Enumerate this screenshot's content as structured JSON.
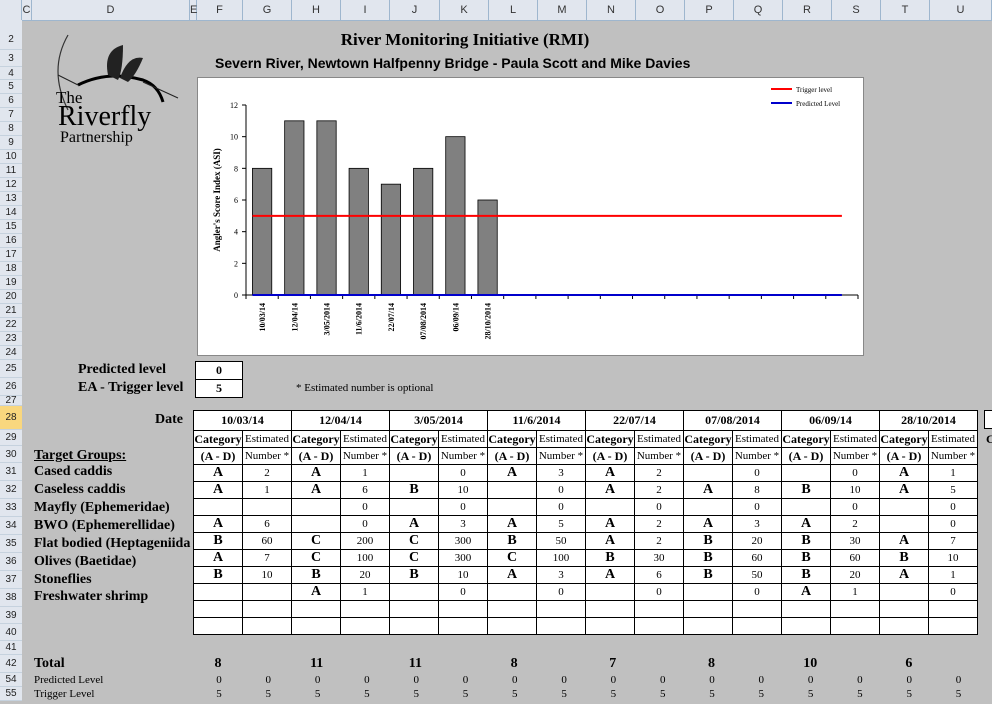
{
  "columns": [
    "C",
    "D",
    "E",
    "F",
    "G",
    "H",
    "I",
    "J",
    "K",
    "L",
    "M",
    "N",
    "O",
    "P",
    "Q",
    "R",
    "S",
    "T",
    "U"
  ],
  "rows": [
    "2",
    "3",
    "4",
    "5",
    "6",
    "7",
    "8",
    "9",
    "10",
    "11",
    "12",
    "13",
    "14",
    "15",
    "16",
    "17",
    "18",
    "19",
    "20",
    "21",
    "22",
    "23",
    "24",
    "25",
    "26",
    "27",
    "28",
    "29",
    "30",
    "31",
    "32",
    "33",
    "34",
    "35",
    "36",
    "37",
    "38",
    "39",
    "40",
    "41",
    "42",
    "54",
    "55"
  ],
  "title": "River Monitoring Initiative (RMI)",
  "subtitle": "Severn River, Newtown Halfpenny Bridge - Paula Scott and Mike Davies",
  "logo": {
    "line1": "The",
    "line2": "Riverfly",
    "line3": "Partnership"
  },
  "predicted_label": "Predicted level",
  "predicted_value": "0",
  "trigger_label": "EA - Trigger level",
  "trigger_value": "5",
  "note": "* Estimated number is optional",
  "date_label": "Date",
  "target_groups_label": "Target Groups:",
  "hdr_category": "Category",
  "hdr_estimated": "Estimated",
  "hdr_ad": "(A - D)",
  "hdr_number": "Number *",
  "overflow_c": "C",
  "dates": [
    "10/03/14",
    "12/04/14",
    "3/05/2014",
    "11/6/2014",
    "22/07/14",
    "07/08/2014",
    "06/09/14",
    "28/10/2014"
  ],
  "groups": [
    {
      "name": "Cased caddis",
      "cells": [
        [
          "A",
          "2"
        ],
        [
          "A",
          "1"
        ],
        [
          "",
          "0"
        ],
        [
          "A",
          "3"
        ],
        [
          "A",
          "2"
        ],
        [
          "",
          "0"
        ],
        [
          "",
          "0"
        ],
        [
          "A",
          "1"
        ]
      ]
    },
    {
      "name": "Caseless caddis",
      "cells": [
        [
          "A",
          "1"
        ],
        [
          "A",
          "6"
        ],
        [
          "B",
          "10"
        ],
        [
          "",
          "0"
        ],
        [
          "A",
          "2"
        ],
        [
          "A",
          "8"
        ],
        [
          "B",
          "10"
        ],
        [
          "A",
          "5"
        ]
      ]
    },
    {
      "name": "Mayfly (Ephemeridae)",
      "cells": [
        [
          "",
          ""
        ],
        [
          "",
          "0"
        ],
        [
          "",
          "0"
        ],
        [
          "",
          "0"
        ],
        [
          "",
          "0"
        ],
        [
          "",
          "0"
        ],
        [
          "",
          "0"
        ],
        [
          "",
          "0"
        ]
      ]
    },
    {
      "name": "BWO (Ephemerellidae)",
      "cells": [
        [
          "A",
          "6"
        ],
        [
          "",
          "0"
        ],
        [
          "A",
          "3"
        ],
        [
          "A",
          "5"
        ],
        [
          "A",
          "2"
        ],
        [
          "A",
          "3"
        ],
        [
          "A",
          "2"
        ],
        [
          "",
          "0"
        ]
      ]
    },
    {
      "name": "Flat bodied (Heptageniida",
      "cells": [
        [
          "B",
          "60"
        ],
        [
          "C",
          "200"
        ],
        [
          "C",
          "300"
        ],
        [
          "B",
          "50"
        ],
        [
          "A",
          "2"
        ],
        [
          "B",
          "20"
        ],
        [
          "B",
          "30"
        ],
        [
          "A",
          "7"
        ]
      ]
    },
    {
      "name": "Olives (Baetidae)",
      "cells": [
        [
          "A",
          "7"
        ],
        [
          "C",
          "100"
        ],
        [
          "C",
          "300"
        ],
        [
          "C",
          "100"
        ],
        [
          "B",
          "30"
        ],
        [
          "B",
          "60"
        ],
        [
          "B",
          "60"
        ],
        [
          "B",
          "10"
        ]
      ]
    },
    {
      "name": "Stoneflies",
      "cells": [
        [
          "B",
          "10"
        ],
        [
          "B",
          "20"
        ],
        [
          "B",
          "10"
        ],
        [
          "A",
          "3"
        ],
        [
          "A",
          "6"
        ],
        [
          "B",
          "50"
        ],
        [
          "B",
          "20"
        ],
        [
          "A",
          "1"
        ]
      ]
    },
    {
      "name": "Freshwater shrimp",
      "cells": [
        [
          "",
          ""
        ],
        [
          "A",
          "1"
        ],
        [
          "",
          "0"
        ],
        [
          "",
          "0"
        ],
        [
          "",
          "0"
        ],
        [
          "",
          "0"
        ],
        [
          "A",
          "1"
        ],
        [
          "",
          "0"
        ]
      ]
    }
  ],
  "total_label": "Total",
  "totals": [
    "8",
    "11",
    "11",
    "8",
    "7",
    "8",
    "10",
    "6"
  ],
  "predicted_row_label": "Predicted Level",
  "trigger_row_label": "Trigger Level",
  "predicted_row": [
    "0",
    "0",
    "0",
    "0",
    "0",
    "0",
    "0",
    "0",
    "0",
    "0",
    "0",
    "0",
    "0",
    "0",
    "0",
    "0"
  ],
  "trigger_row": [
    "5",
    "5",
    "5",
    "5",
    "5",
    "5",
    "5",
    "5",
    "5",
    "5",
    "5",
    "5",
    "5",
    "5",
    "5",
    "5"
  ],
  "chart_data": {
    "type": "bar",
    "categories": [
      "10/03/14",
      "12/04/14",
      "3/05/2014",
      "11/6/2014",
      "22/07/14",
      "07/08/2014",
      "06/09/14",
      "28/10/2014"
    ],
    "values": [
      8,
      11,
      11,
      8,
      7,
      8,
      10,
      6
    ],
    "extra_slots": 11,
    "ylabel": "Angler's Score Index (ASI)",
    "ylim": [
      0,
      12
    ],
    "yticks": [
      "0",
      "2",
      "4",
      "6",
      "8",
      "10",
      "12"
    ],
    "legend": [
      {
        "name": "Trigger level",
        "color": "#ff0000",
        "value": 5
      },
      {
        "name": "Predicted Level",
        "color": "#0000cc",
        "value": 0
      }
    ],
    "bar_color": "#808080",
    "legend_position": "top-right"
  }
}
